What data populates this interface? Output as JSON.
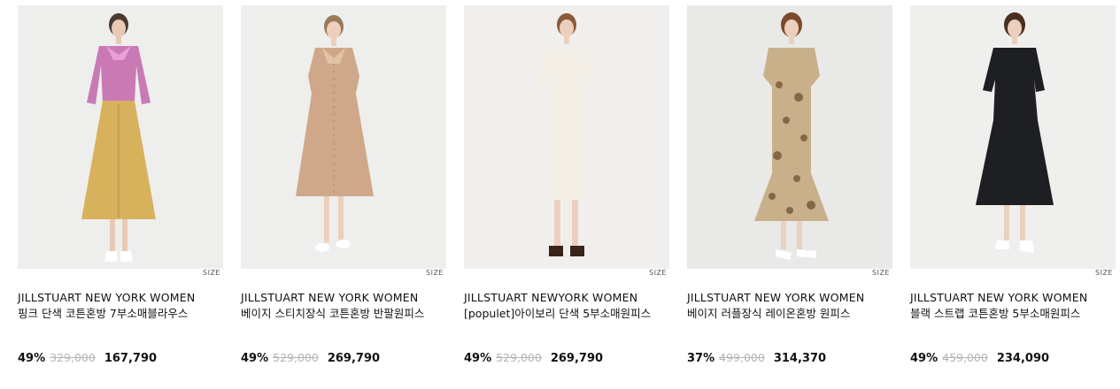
{
  "products": [
    {
      "brand": "JILLSTUART NEW YORK WOMEN",
      "name": "핑크 단색 코튼혼방 7부소매블라우스",
      "size_label": "SIZE",
      "discount": "49%",
      "original_price": "329,000",
      "sale_price": "167,790",
      "bg_color": "#eeeeec",
      "top_color": "#c97ab5",
      "bottom_color": "#d8b15c"
    },
    {
      "brand": "JILLSTUART NEW YORK WOMEN",
      "name": "베이지 스티치장식 코튼혼방 반팔원피스",
      "size_label": "SIZE",
      "discount": "49%",
      "original_price": "529,000",
      "sale_price": "269,790",
      "bg_color": "#eeeeec",
      "top_color": "#cfa88a",
      "bottom_color": "#cfa88a"
    },
    {
      "brand": "JILLSTUART NEWYORK WOMEN",
      "name": "[populet]아이보리 단색 5부소매원피스",
      "size_label": "SIZE",
      "discount": "49%",
      "original_price": "529,000",
      "sale_price": "269,790",
      "bg_color": "#f0efed",
      "top_color": "#f3efe6",
      "bottom_color": "#f3efe6"
    },
    {
      "brand": "JILLSTUART NEW YORK WOMEN",
      "name": "베이지 러플장식 레이온혼방 원피스",
      "size_label": "SIZE",
      "discount": "37%",
      "original_price": "499,000",
      "sale_price": "314,370",
      "bg_color": "#e9e9e7",
      "top_color": "#c8b08a",
      "bottom_color": "#c8b08a"
    },
    {
      "brand": "JILLSTUART NEW YORK WOMEN",
      "name": "블랙 스트랩 코튼혼방 5부소매원피스",
      "size_label": "SIZE",
      "discount": "49%",
      "original_price": "459,000",
      "sale_price": "234,090",
      "bg_color": "#efefed",
      "top_color": "#1e1f22",
      "bottom_color": "#1e1f22"
    }
  ]
}
